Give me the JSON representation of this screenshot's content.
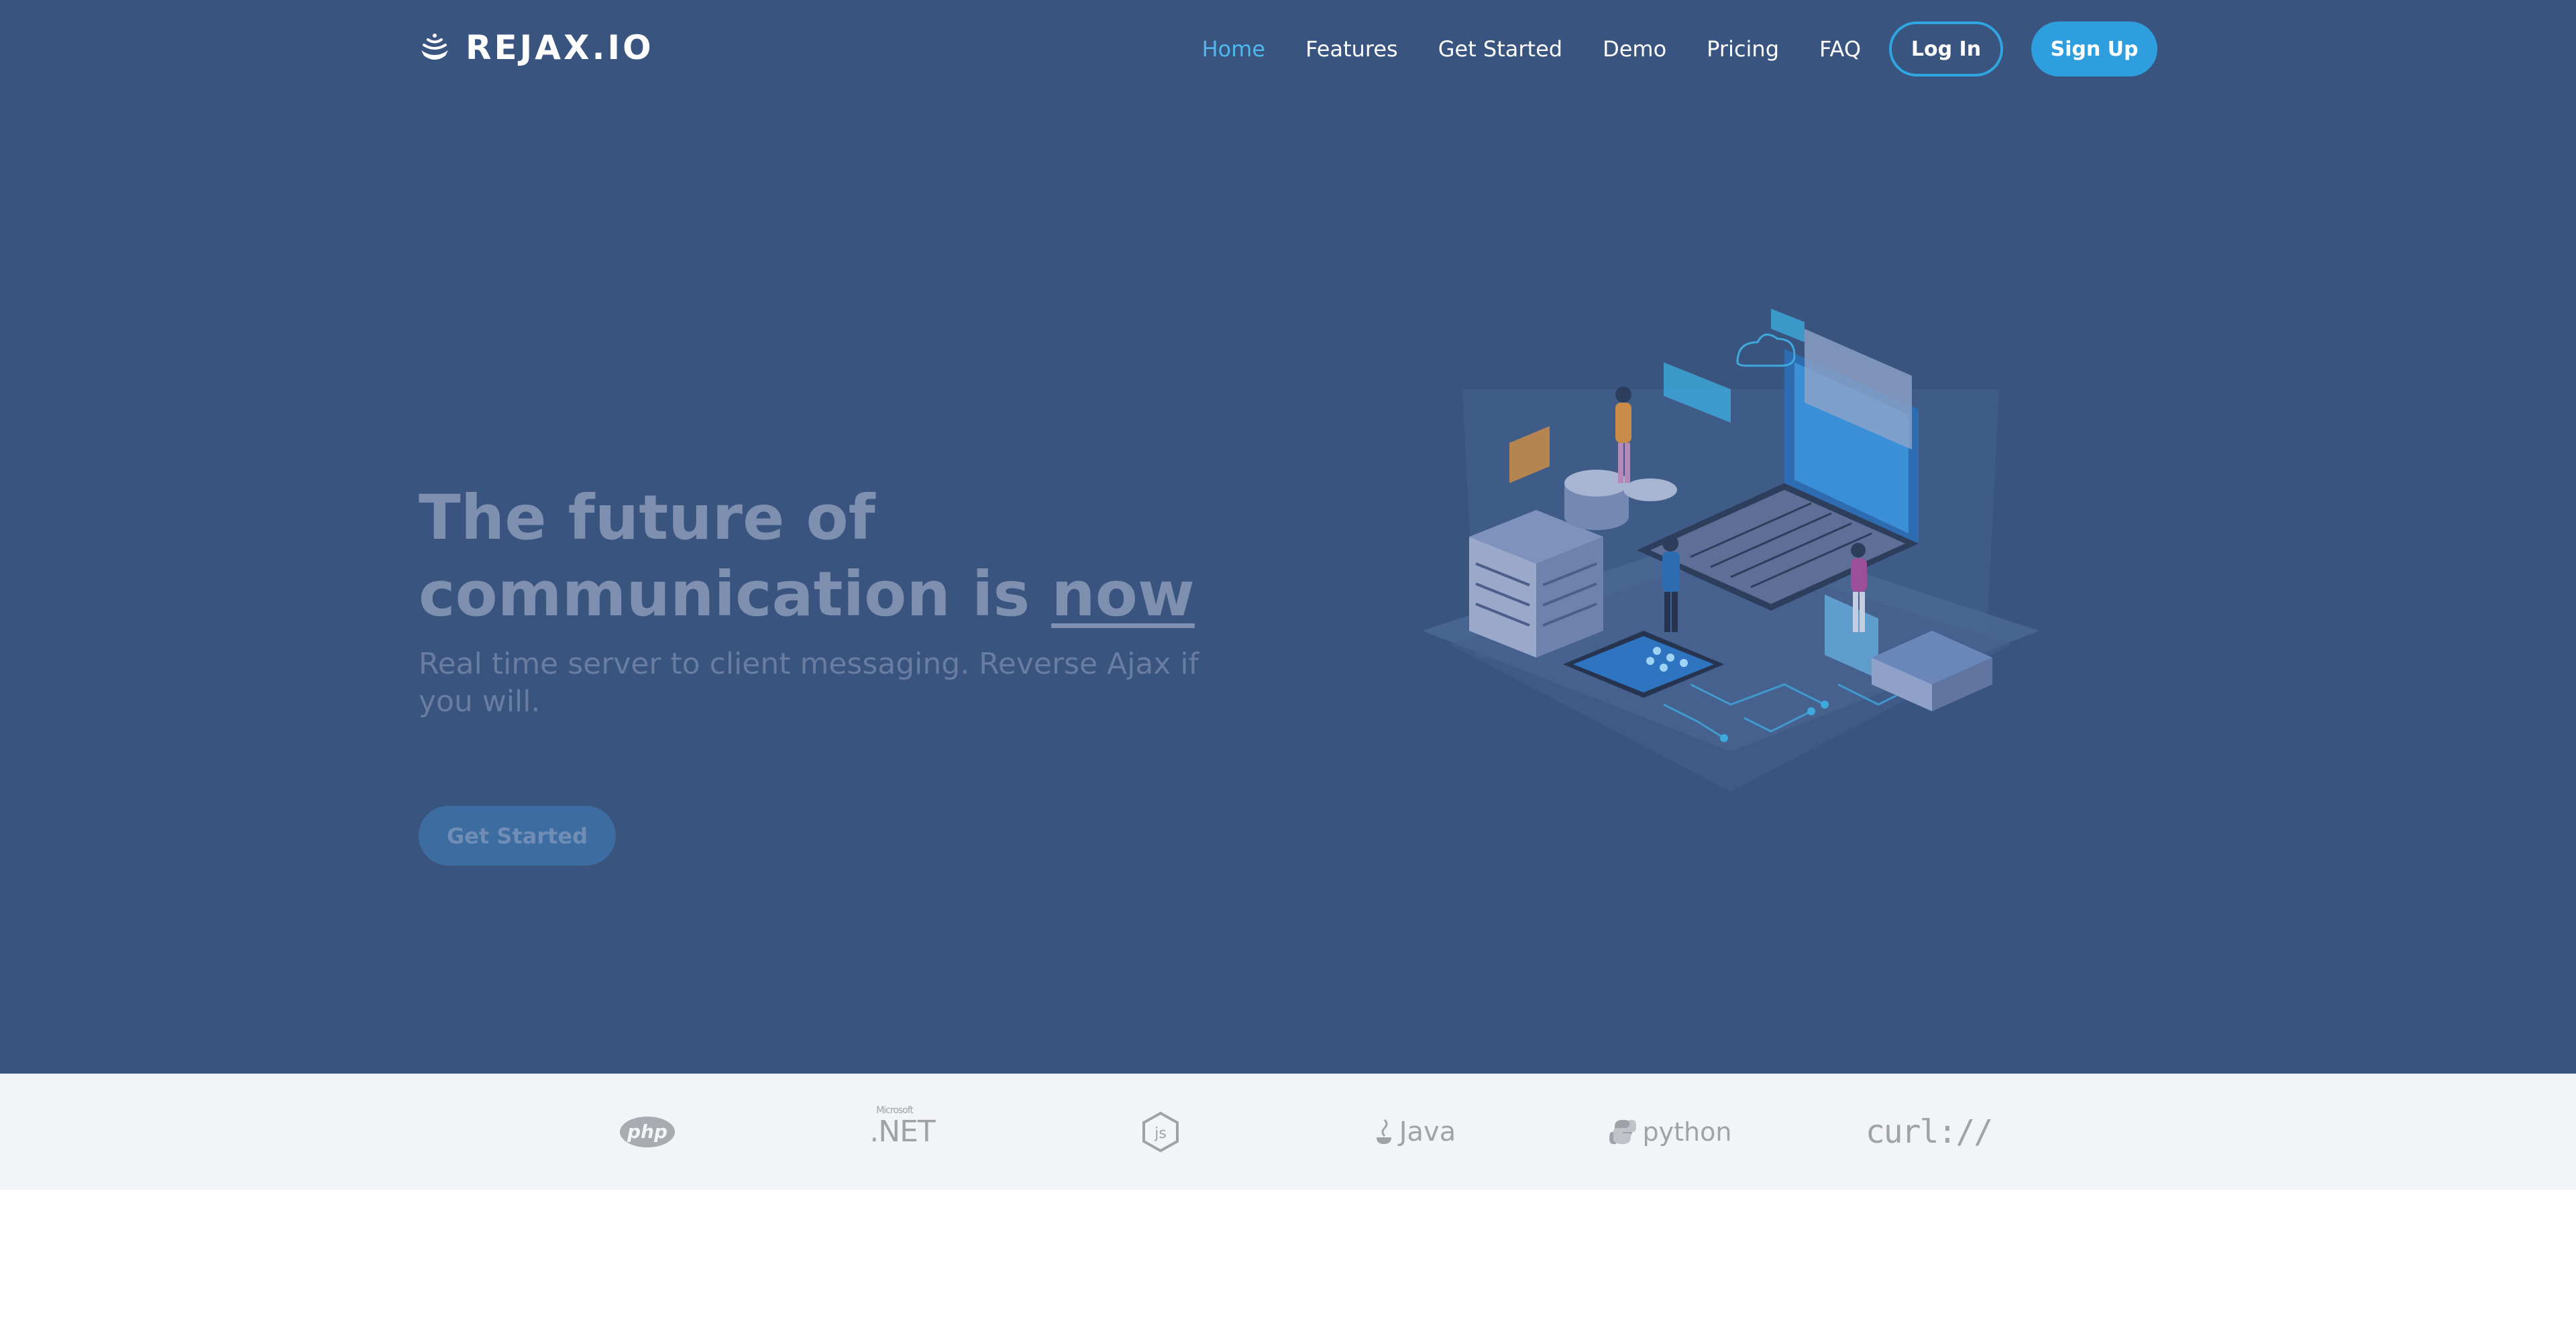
{
  "brand": {
    "name": "REJAX.IO",
    "icon": "wifi-cup-icon"
  },
  "nav": {
    "links": [
      "Home",
      "Features",
      "Get Started",
      "Demo",
      "Pricing",
      "FAQ"
    ],
    "active": "Home",
    "login_label": "Log In",
    "signup_label": "Sign Up"
  },
  "hero": {
    "headline_part1": "The future of communication is",
    "headline_accent": "now",
    "subheadline": "Real time server to client messaging. Reverse Ajax if you will.",
    "cta_label": "Get Started",
    "illustration": "isometric-server-laptop-illustration"
  },
  "logos": {
    "php": "php",
    "net_small": "Microsoft",
    "net": ".NET",
    "node": "js",
    "java": "Java",
    "python": "python",
    "curl": "curl://"
  },
  "colors": {
    "hero_bg": "#38547f",
    "accent": "#2e9ede",
    "active_link": "#4fb8ec",
    "logos_bg": "#f3f4f8"
  }
}
